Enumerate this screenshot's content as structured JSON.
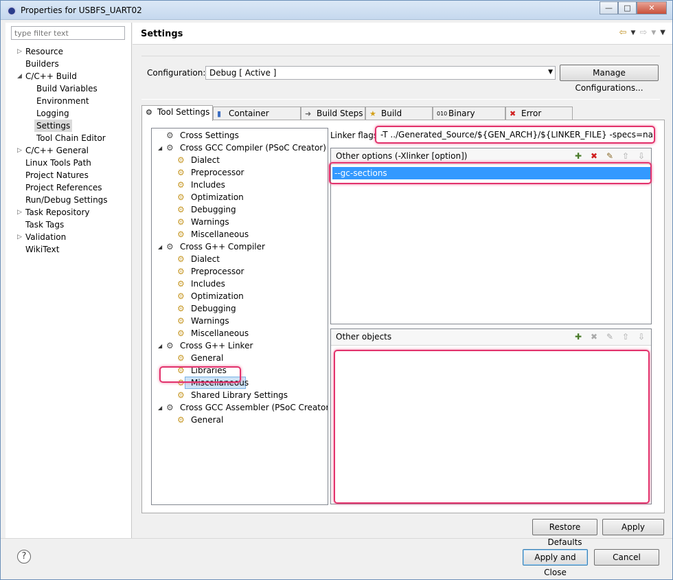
{
  "window": {
    "title": "Properties for USBFS_UART02",
    "min_icon": "minimize-icon",
    "max_icon": "maximize-icon",
    "close_icon": "close-icon"
  },
  "left": {
    "filter_placeholder": "type filter text",
    "items": [
      {
        "label": "Resource"
      },
      {
        "label": "Builders"
      },
      {
        "label": "C/C++ Build"
      },
      {
        "label": "Build Variables"
      },
      {
        "label": "Environment"
      },
      {
        "label": "Logging"
      },
      {
        "label": "Settings"
      },
      {
        "label": "Tool Chain Editor"
      },
      {
        "label": "C/C++ General"
      },
      {
        "label": "Linux Tools Path"
      },
      {
        "label": "Project Natures"
      },
      {
        "label": "Project References"
      },
      {
        "label": "Run/Debug Settings"
      },
      {
        "label": "Task Repository"
      },
      {
        "label": "Task Tags"
      },
      {
        "label": "Validation"
      },
      {
        "label": "WikiText"
      }
    ]
  },
  "settings": {
    "title": "Settings",
    "config_label": "Configuration:",
    "config_value": "Debug  [ Active ]",
    "manage_label": "Manage Configurations...",
    "tabs": [
      {
        "label": "Tool Settings"
      },
      {
        "label": "Container Settings"
      },
      {
        "label": "Build Steps"
      },
      {
        "label": "Build Artifact"
      },
      {
        "label": "Binary Parsers"
      },
      {
        "label": "Error Parsers"
      }
    ],
    "tool_tree": [
      {
        "label": "Cross Settings"
      },
      {
        "label": "Cross GCC Compiler (PSoC Creator)"
      },
      {
        "label": "Dialect"
      },
      {
        "label": "Preprocessor"
      },
      {
        "label": "Includes"
      },
      {
        "label": "Optimization"
      },
      {
        "label": "Debugging"
      },
      {
        "label": "Warnings"
      },
      {
        "label": "Miscellaneous"
      },
      {
        "label": "Cross G++ Compiler"
      },
      {
        "label": "Dialect"
      },
      {
        "label": "Preprocessor"
      },
      {
        "label": "Includes"
      },
      {
        "label": "Optimization"
      },
      {
        "label": "Debugging"
      },
      {
        "label": "Warnings"
      },
      {
        "label": "Miscellaneous"
      },
      {
        "label": "Cross G++ Linker"
      },
      {
        "label": "General"
      },
      {
        "label": "Libraries"
      },
      {
        "label": "Miscellaneous"
      },
      {
        "label": "Shared Library Settings"
      },
      {
        "label": "Cross GCC Assembler (PSoC Creator)"
      },
      {
        "label": "General"
      }
    ],
    "linker_flags_label": "Linker flags",
    "linker_flags_value": "-T ../Generated_Source/${GEN_ARCH}/${LINKER_FILE} -specs=nano.specs",
    "other_options_label": "Other options (-Xlinker [option])",
    "other_options_items": [
      "--gc-sections"
    ],
    "other_objects_label": "Other objects"
  },
  "buttons": {
    "restore": "Restore Defaults",
    "apply": "Apply",
    "apply_close": "Apply and Close",
    "cancel": "Cancel",
    "help": "?"
  }
}
